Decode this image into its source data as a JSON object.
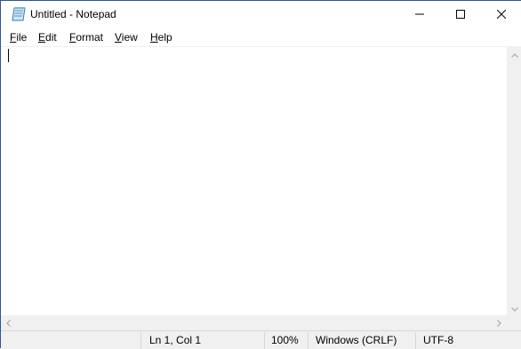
{
  "window": {
    "title": "Untitled - Notepad",
    "icons": {
      "app": "notepad-icon",
      "minimize": "minimize-icon",
      "maximize": "maximize-icon",
      "close": "close-icon"
    }
  },
  "menu": {
    "items": [
      {
        "first": "F",
        "rest": "ile"
      },
      {
        "first": "E",
        "rest": "dit"
      },
      {
        "first": "F",
        "rest": "ormat"
      },
      {
        "first": "V",
        "rest": "iew"
      },
      {
        "first": "H",
        "rest": "elp"
      }
    ]
  },
  "editor": {
    "content": ""
  },
  "statusbar": {
    "position": "Ln 1, Col 1",
    "zoom": "100%",
    "line_ending": "Windows (CRLF)",
    "encoding": "UTF-8"
  }
}
